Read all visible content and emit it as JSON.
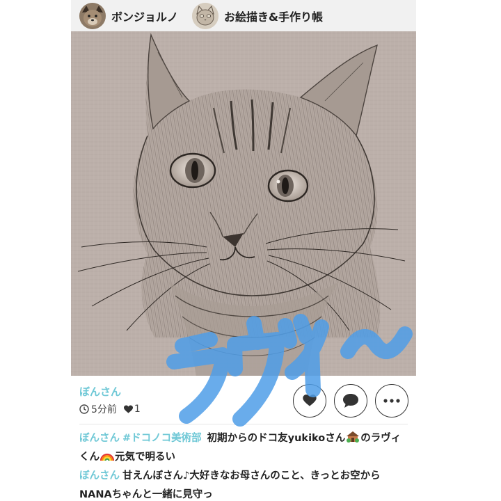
{
  "header": {
    "crumbs": [
      {
        "label": "ボンジョルノ"
      },
      {
        "label": "お絵描き&手作り帳"
      }
    ]
  },
  "post": {
    "author": "ぼんさん",
    "time_ago": "5分前",
    "like_count": "1",
    "overlay_text": "ラヴィ〜"
  },
  "comments": [
    {
      "author": "ぼんさん",
      "tag": "#ドコノコ美術部",
      "text_a": "初期からのドコ友yukikoさん",
      "text_b": "のラヴィくん",
      "text_c": "元気で明るい"
    },
    {
      "author": "ぼんさん",
      "text": "甘えんぼさん♪大好きなお母さんのこと、きっとお空からNANAちゃんと一緒に見守っ"
    }
  ],
  "colors": {
    "accent": "#6fc8d6",
    "overlay_text": "#4f9ee8",
    "topbar": "#f1f1f1"
  }
}
